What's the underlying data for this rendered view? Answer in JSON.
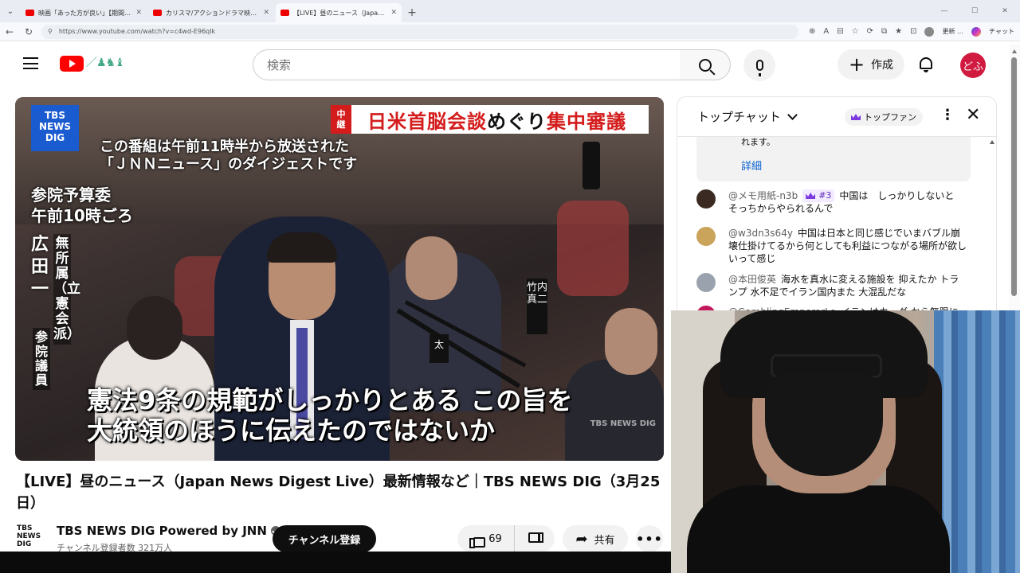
{
  "browser": {
    "tabs": [
      {
        "title": "映画「あった方が良い」【期間限定公開】",
        "active": false
      },
      {
        "title": "カリスマ/アクションドラマ映画/映画好き",
        "active": false
      },
      {
        "title": "【LIVE】昼のニュース（Japan News",
        "active": true
      }
    ],
    "new_tab": "+",
    "url": "https://www.youtube.com/watch?v=c4wd-E96qlk",
    "update_label": "更新 …",
    "chat_label": "チャット"
  },
  "header": {
    "search_placeholder": "検索",
    "create_label": "作成",
    "avatar_text": "どふ"
  },
  "video": {
    "tbs_logo": [
      "TBS",
      "NEWS",
      "DIG"
    ],
    "banner_tag": [
      "中",
      "継"
    ],
    "banner_text_red1": "日米首脳会談",
    "banner_text_black": "めぐり",
    "banner_text_red2": "集中審議",
    "notice": "この番組は午前11時半から放送された\n「ＪＮＮニュース」のダイジェストです",
    "place_line1": "参院予算委",
    "place_line2": "午前10時ごろ",
    "speaker_name": "広田一",
    "speaker_party": "無所属（立憲会派）",
    "speaker_role": "参院議員",
    "subtitle": "憲法9条の規範がしっかりとある この旨を\n大統領のほうに伝えたのではないか",
    "watermark": "TBS NEWS DIG",
    "nameplate": "竹内真二",
    "nameplate3": "太"
  },
  "title": "【LIVE】昼のニュース（Japan News Digest Live）最新情報など｜TBS NEWS DIG（3月25日）",
  "channel": {
    "logo": "TBS NEWS DIG",
    "name": "TBS NEWS DIG Powered by JNN",
    "subscribers": "チャンネル登録者数 321万人",
    "subscribe_label": "チャンネル登録"
  },
  "actions": {
    "likes": "69",
    "share_label": "共有",
    "more_label": "•••"
  },
  "chat": {
    "mode_label": "トップチャット",
    "top_fan_label": "トップファン",
    "pinned_text": "れます。",
    "pinned_more": "詳細",
    "messages": [
      {
        "author": "@メモ用紙-n3b",
        "badge": "#3",
        "text": "中国は　しっかりしないと　そっちからやられるんで",
        "avatar_color": "#3a2a22"
      },
      {
        "author": "@w3dn3s64y",
        "badge": "",
        "text": "中国は日本と同じ感じでいまバブル崩壊仕掛けてるから何としても利益につながる場所が欲しいって感じ",
        "avatar_color": "#c9a45a"
      },
      {
        "author": "@本田俊英",
        "badge": "",
        "text": "海水を真水に変える施設を 抑えたか トランプ 水不足でイラン国内また 大混乱だな",
        "avatar_color": "#9aa3ad"
      },
      {
        "author": "@GamblingEmperorLe",
        "badge": "",
        "text": "イランはカーグ から無限に売れ",
        "avatar_color": "#c2185b"
      }
    ]
  },
  "colors": {
    "youtube_red": "#ff0000",
    "subscribe_bg": "#0f0f0f",
    "banner_red": "#d41c1c",
    "tbs_blue": "#1a5bd0",
    "avatar_bg": "#d01a3f"
  }
}
